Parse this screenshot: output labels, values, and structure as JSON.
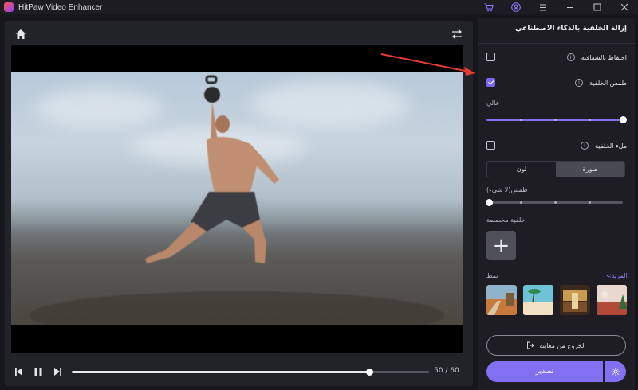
{
  "app": {
    "title": "HitPaw Video Enhancer"
  },
  "titlebar": {
    "cart": "cart-icon",
    "account": "user-icon",
    "menu": "menu-icon",
    "minimize": "minimize-icon",
    "maximize": "maximize-icon",
    "close": "close-icon"
  },
  "player": {
    "time_current": "50",
    "time_total": "60",
    "time_separator": "/",
    "progress": 0.833
  },
  "panel": {
    "title": "إزالة الخلفية بالذكاء الاصطناعي",
    "keep_transparency": {
      "label": "احتفاظ بالشفافية",
      "checked": false
    },
    "blur_background": {
      "label": "طمس الخلفية",
      "checked": true
    },
    "blur_level_label": "عالي",
    "blur_level": 1.0,
    "fill_background": {
      "label": "ملء الخلفية",
      "checked": false
    },
    "tabs": [
      {
        "label": "لون",
        "active": false
      },
      {
        "label": "صورة",
        "active": true
      }
    ],
    "blur_none_label": "طمس(لا شيء)",
    "blur_none_level": 0.0,
    "custom_background_label": "خلفية مخصصة",
    "add_symbol": "+",
    "style_label": "نمط",
    "more_link": "المزيد>",
    "exit_label": "الخروج من معاينة",
    "export_label": "تصدير"
  },
  "colors": {
    "accent": "#8170f2",
    "arrow": "#e53935"
  }
}
